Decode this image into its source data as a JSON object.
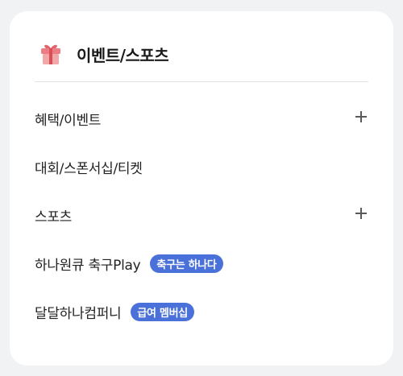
{
  "panel": {
    "icon": "gift-icon",
    "title": "이벤트/스포츠"
  },
  "items": [
    {
      "label": "혜택/이벤트",
      "expand_icon": "plus-icon"
    },
    {
      "label": "대회/스폰서십/티켓"
    },
    {
      "label": "스포츠",
      "expand_icon": "plus-icon"
    },
    {
      "label": "하나원큐 축구Play",
      "badge": "축구는 하나다"
    },
    {
      "label": "달달하나컴퍼니",
      "badge": "급여 멤버십"
    }
  ],
  "colors": {
    "badge_bg": "#4a70d9",
    "gift_red": "#e2626a",
    "gift_light": "#f2a8a8",
    "background": "#f1f2f4"
  }
}
